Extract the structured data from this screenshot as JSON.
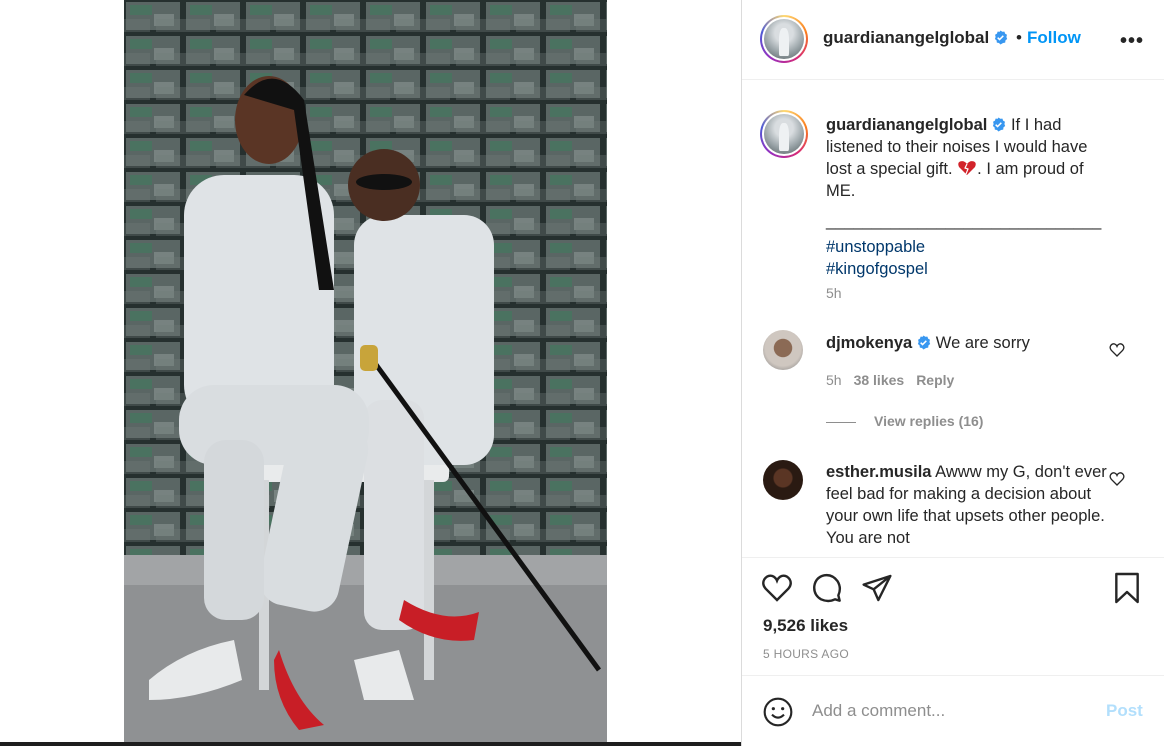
{
  "header": {
    "username": "guardianangelglobal",
    "separator": "•",
    "follow_label": "Follow",
    "more_icon": "more-options-icon"
  },
  "caption": {
    "username": "guardianangelglobal",
    "text_before_emoji": "If I had listened to their noises I would have lost a special gift.",
    "emoji": "broken-heart",
    "text_after_emoji": ". I am proud of ME.",
    "divider": "______________________________",
    "hashtags": [
      "#unstoppable",
      "#kingofgospel"
    ],
    "age": "5h"
  },
  "comments": [
    {
      "username": "djmokenya",
      "verified": true,
      "text": "We are sorry",
      "age": "5h",
      "likes": "38 likes",
      "reply_label": "Reply",
      "view_replies": "View replies (16)"
    },
    {
      "username": "esther.musila",
      "verified": false,
      "text": "Awww my G, don't ever feel bad for making a decision about your own life that upsets other people. You are not"
    }
  ],
  "actions": {
    "likes": "9,526 likes",
    "timestamp": "5 HOURS AGO"
  },
  "add_comment": {
    "placeholder": "Add a comment...",
    "post_label": "Post"
  },
  "colors": {
    "accent": "#0095f6",
    "hashtag": "#00376b",
    "muted": "#8e8e8e",
    "post_disabled": "#b2dffc"
  }
}
